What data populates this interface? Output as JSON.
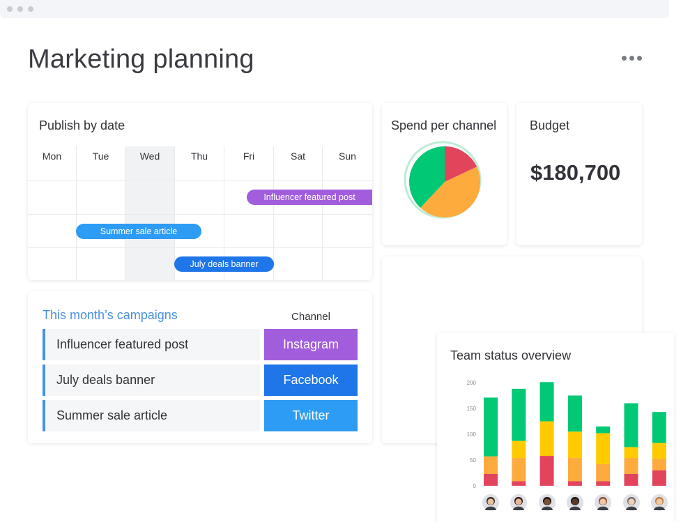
{
  "window": {
    "dots": 3
  },
  "page": {
    "title": "Marketing planning"
  },
  "calendar": {
    "title": "Publish by date",
    "days": [
      "Mon",
      "Tue",
      "Wed",
      "Thu",
      "Fri",
      "Sat",
      "Sun"
    ],
    "events": [
      {
        "label": "Influencer featured post",
        "color": "#a25ddc"
      },
      {
        "label": "Summer sale article",
        "color": "#2d9cf4"
      },
      {
        "label": "July deals banner",
        "color": "#1f76e8"
      }
    ]
  },
  "campaigns": {
    "title": "This month’s campaigns",
    "channel_header": "Channel",
    "rows": [
      {
        "name": "Influencer featured post",
        "channel": "Instagram",
        "color": "#a25ddc"
      },
      {
        "name": "July deals banner",
        "channel": "Facebook",
        "color": "#1f76e8"
      },
      {
        "name": "Summer sale article",
        "channel": "Twitter",
        "color": "#2d9cf4"
      }
    ]
  },
  "spend": {
    "title": "Spend per channel"
  },
  "budget": {
    "title": "Budget",
    "value": "$180,700"
  },
  "team": {
    "title": "Team status overview"
  },
  "chart_data": {
    "type": "bar",
    "stacked": true,
    "yticks": [
      "200",
      "150",
      "100",
      "50",
      "0"
    ],
    "ylim": [
      0,
      200
    ],
    "grid": false,
    "series": [
      {
        "color": "#e2445c",
        "values": [
          23,
          9,
          58,
          9,
          9,
          23,
          30
        ]
      },
      {
        "color": "#fdab3d",
        "values": [
          34,
          45,
          0,
          45,
          33,
          31,
          22
        ]
      },
      {
        "color": "#ffcb00",
        "values": [
          0,
          33,
          67,
          51,
          60,
          21,
          31
        ]
      },
      {
        "color": "#00c875",
        "values": [
          114,
          101,
          76,
          70,
          13,
          85,
          60
        ]
      }
    ]
  },
  "spend_chart_data": {
    "type": "pie",
    "slices": [
      {
        "color": "#e2445c",
        "value": 18
      },
      {
        "color": "#fdab3d",
        "value": 44
      },
      {
        "color": "#00c875",
        "value": 38
      }
    ]
  },
  "avatars": [
    {
      "icon": "avatar-man-icon",
      "skin": "#e8c2a0",
      "hair": "#3b2a20"
    },
    {
      "icon": "avatar-woman-icon",
      "skin": "#e6b896",
      "hair": "#2a1a14"
    },
    {
      "icon": "avatar-man-icon",
      "skin": "#7a5236",
      "hair": "#1b120c"
    },
    {
      "icon": "avatar-man-icon",
      "skin": "#5b3b28",
      "hair": "#111111"
    },
    {
      "icon": "avatar-woman-icon",
      "skin": "#edc6a6",
      "hair": "#8a4a2a"
    },
    {
      "icon": "avatar-man-icon",
      "skin": "#f0cfb4",
      "hair": "#6a6a6a"
    },
    {
      "icon": "avatar-woman-icon",
      "skin": "#eec7a4",
      "hair": "#c07a3a"
    }
  ]
}
